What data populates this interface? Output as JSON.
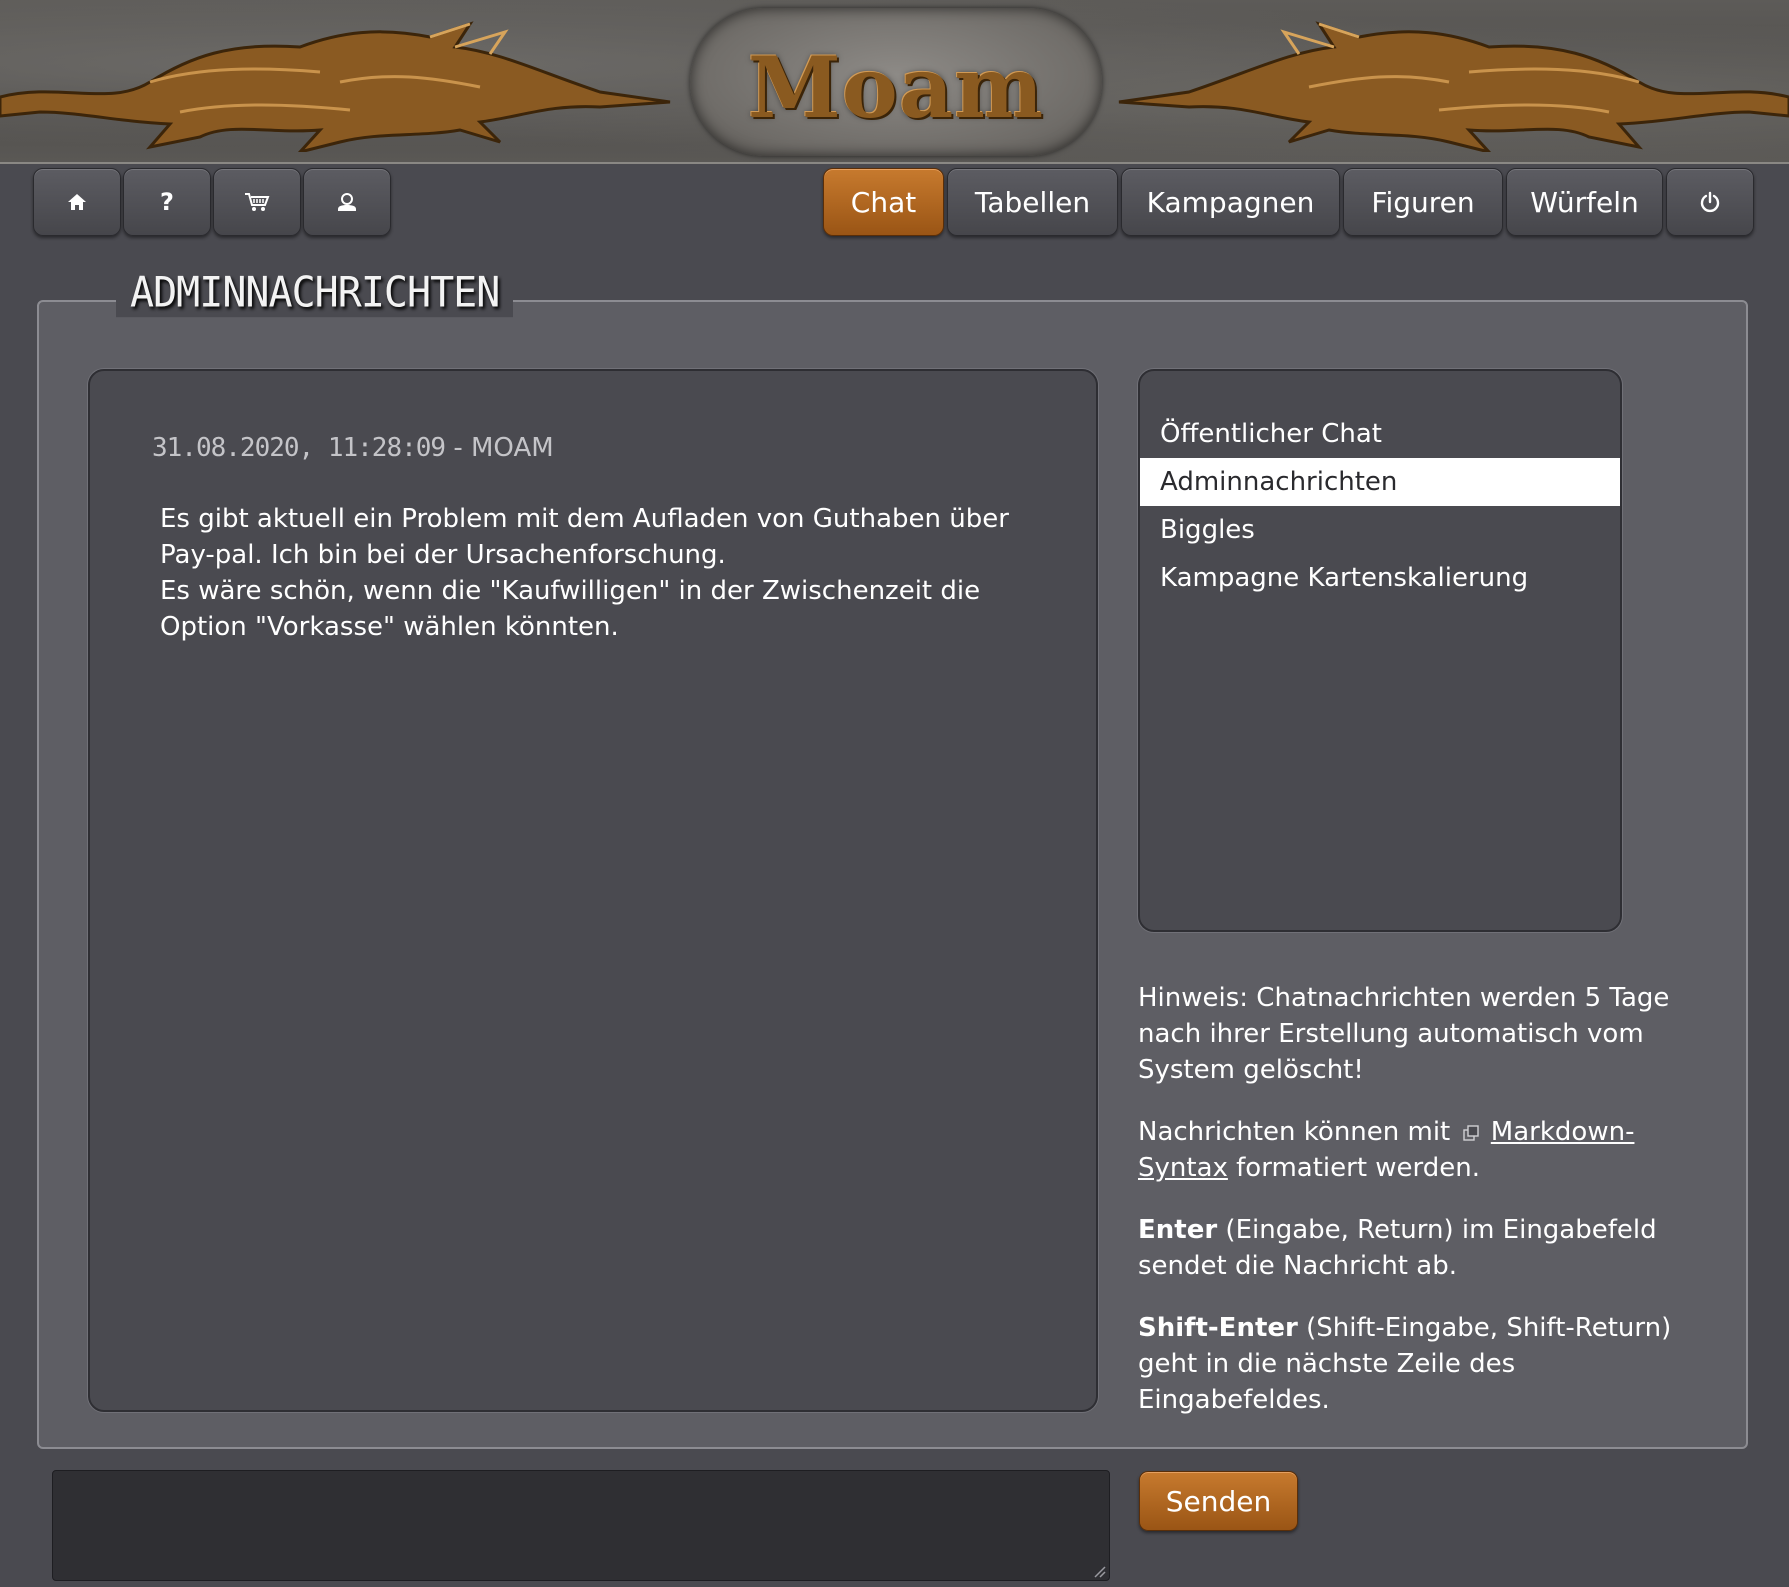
{
  "header": {
    "logo_text": "Moam"
  },
  "nav": {
    "icons": [
      {
        "name": "home-icon"
      },
      {
        "name": "help-icon",
        "glyph": "?"
      },
      {
        "name": "cart-icon"
      },
      {
        "name": "profile-icon"
      }
    ],
    "tabs": [
      {
        "label": "Chat",
        "active": true
      },
      {
        "label": "Tabellen",
        "active": false
      },
      {
        "label": "Kampagnen",
        "active": false
      },
      {
        "label": "Figuren",
        "active": false
      },
      {
        "label": "Würfeln",
        "active": false
      }
    ],
    "power_icon": "power-icon"
  },
  "panel": {
    "title": "ADMINNACHRICHTEN"
  },
  "message": {
    "timestamp": "31.08.2020, 11:28:09",
    "separator": " - ",
    "author": "MOAM",
    "body": [
      "Es gibt aktuell ein Problem mit dem Aufladen von Guthaben über Pay-pal. Ich bin bei der Ursachenforschung.",
      "Es wäre schön, wenn die \"Kaufwilligen\" in der Zwischenzeit die Option \"Vorkasse\" wählen könnten."
    ]
  },
  "channels": {
    "items": [
      {
        "label": "Öffentlicher Chat",
        "selected": false
      },
      {
        "label": "Adminnachrichten",
        "selected": true
      },
      {
        "label": "Biggles",
        "selected": false
      },
      {
        "label": "Kampagne Kartenskalierung",
        "selected": false
      }
    ]
  },
  "hints": {
    "retention": "Hinweis: Chatnachrichten werden 5 Tage nach ihrer Erstellung automatisch vom System gelöscht!",
    "markdown_prefix": "Nachrichten können mit",
    "markdown_link": "Markdown-Syntax",
    "markdown_suffix": "formatiert werden.",
    "enter_key": "Enter",
    "enter_text": "(Eingabe, Return) im Eingabefeld sendet die Nachricht ab.",
    "shift_enter_key": "Shift-Enter",
    "shift_enter_text": "(Shift-Eingabe, Shift-Return) geht in die nächste Zeile des Eingabefeldes."
  },
  "input": {
    "value": "",
    "placeholder": "",
    "send_label": "Senden"
  },
  "colors": {
    "accent": "#b26a24",
    "background": "#4a4a50",
    "panel": "#5e5e64",
    "selected_row": "#ffffff"
  }
}
